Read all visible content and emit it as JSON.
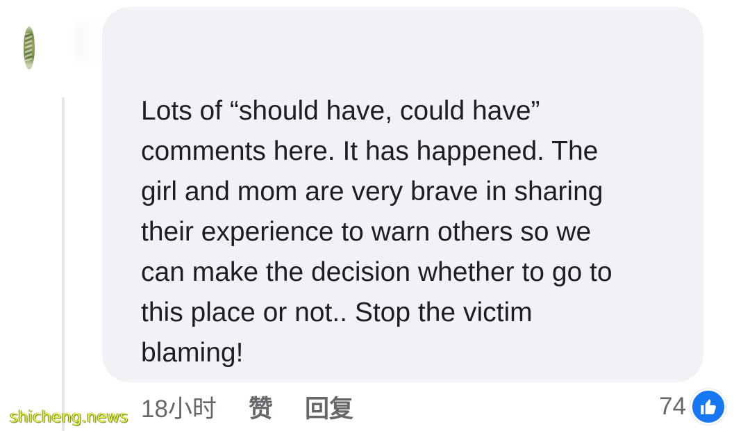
{
  "comment": {
    "lines": [
      "Lots of “should have, could have”",
      "comments here. It has happened. The",
      "girl and mom are very brave in sharing",
      "their experience to warn others so we",
      "can make the decision whether to go to",
      "this place or not.. Stop the victim",
      "blaming!"
    ],
    "bubble_color": "#f0f2f5",
    "text_color": "#1c1e21"
  },
  "actions": {
    "timestamp": "18小时",
    "like_label": "赞",
    "reply_label": "回复"
  },
  "reactions": {
    "count": "74",
    "icon": "thumbs-up-icon",
    "badge_color": "#1877f2"
  },
  "watermark": {
    "text": "shicheng.news",
    "color": "#e2f24a"
  }
}
